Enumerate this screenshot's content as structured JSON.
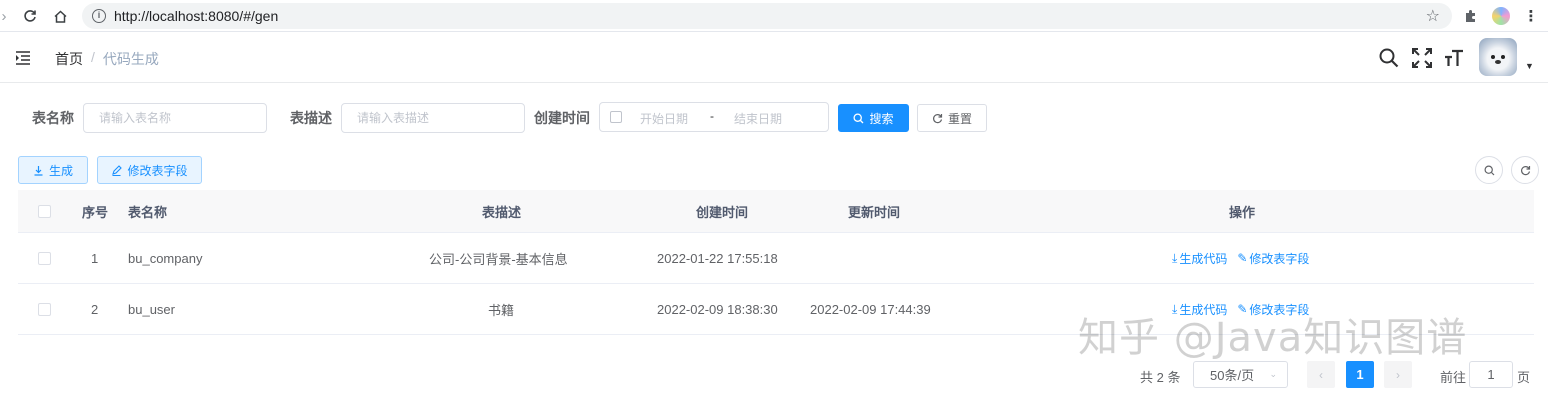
{
  "browser": {
    "url": "http://localhost:8080/#/gen"
  },
  "header": {
    "breadcrumb": {
      "home": "首页",
      "separator": "/",
      "current": "代码生成"
    }
  },
  "search_form": {
    "table_name_label": "表名称",
    "table_name_placeholder": "请输入表名称",
    "table_desc_label": "表描述",
    "table_desc_placeholder": "请输入表描述",
    "create_time_label": "创建时间",
    "start_date_placeholder": "开始日期",
    "date_separator": "-",
    "end_date_placeholder": "结束日期",
    "search_button": "搜索",
    "reset_button": "重置"
  },
  "toolbar": {
    "generate_button": "生成",
    "edit_fields_button": "修改表字段"
  },
  "table": {
    "columns": [
      "序号",
      "表名称",
      "表描述",
      "创建时间",
      "更新时间",
      "操作"
    ],
    "rows": [
      {
        "index": "1",
        "table_name": "bu_company",
        "description": "公司-公司背景-基本信息",
        "create_time": "2022-01-22 17:55:18",
        "update_time": "",
        "op_generate": "生成代码",
        "op_edit": "修改表字段"
      },
      {
        "index": "2",
        "table_name": "bu_user",
        "description": "书籍",
        "create_time": "2022-02-09 18:38:30",
        "update_time": "2022-02-09 17:44:39",
        "op_generate": "生成代码",
        "op_edit": "修改表字段"
      }
    ]
  },
  "pagination": {
    "total_text": "共 2 条",
    "page_size": "50条/页",
    "current_page": "1",
    "goto_label": "前往",
    "goto_value": "1",
    "page_suffix": "页"
  },
  "watermark": "知乎 @Java知识图谱",
  "colors": {
    "primary": "#1890ff",
    "header_bg": "#f8f8f9"
  }
}
